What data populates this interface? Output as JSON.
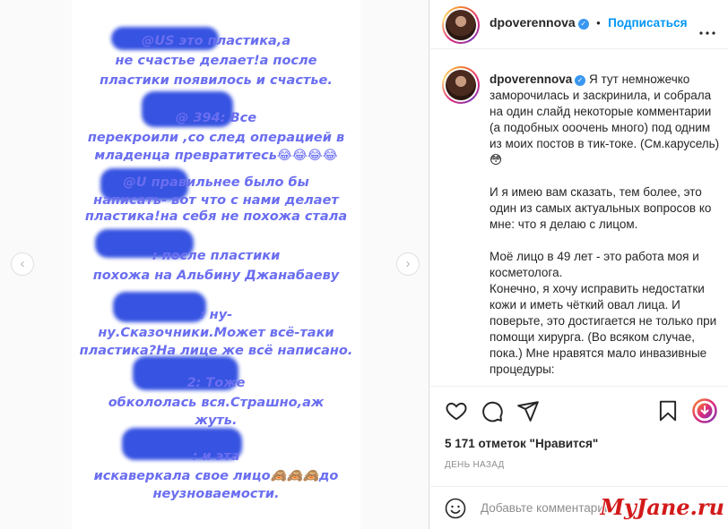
{
  "story": {
    "lines": [
      "@US                это пластика,а",
      "не счастье делает!а после",
      "пластики появилось и счастье.",
      "@            394:  Все",
      "перекроили ,со след операцией в",
      "младенца превратитесь😂😂😂😂",
      "@U                   правильнее было бы",
      "написать- вот что с нами делает",
      "пластика!на себя не похожа стала",
      "                    :  после пластики",
      "похожа на Альбину Джанабаеву",
      "                    :   ну-",
      "ну.Сказочники.Может всё-таки",
      "пластика?На лице же всё написано.",
      "                  2:  Тоже",
      "обкололась вся.Страшно,аж",
      "жуть.",
      "                    :  и эта",
      "искаверкала свое лицо🙈🙈🙈до",
      "неузноваемости."
    ]
  },
  "nav": {
    "prev_icon": "‹",
    "next_icon": "›"
  },
  "header": {
    "username": "dpoverennova",
    "verified_icon": "✓",
    "follow_label": "Подписаться",
    "separator": "•"
  },
  "caption": {
    "username": "dpoverennova",
    "paragraphs": [
      "Я тут немножечко заморочилась и заскринила, и собрала на один слайд некоторые комментарии (а подобных ооочень много) под одним из моих постов в тик-токе. (См.карусель) 😳",
      "И я имею вам сказать, тем более, это один из самых актуальных вопросов ко мне: что я делаю с лицом.",
      "Моё лицо в 49 лет - это работа моя и косметолога.",
      "Конечно, я хочу исправить недостатки кожи и иметь чёткий овал лица. И поверьте, это достигается не только при помощи хирурга. (Во всяком случае, пока.) Мне нравятся мало инвазивные процедуры:"
    ]
  },
  "stats": {
    "likes": "5 171 отметок \"Нравится\"",
    "time": "ДЕНЬ НАЗАД"
  },
  "comment": {
    "placeholder": "Добавьте комментарий",
    "emoji_icon": "☺"
  },
  "watermark": "MyJane.ru",
  "colors": {
    "story_text": "#6a6ef0",
    "redaction": "#2c4ae0",
    "link": "#0095f6",
    "verified": "#3897f0",
    "save_accent": "#dd2a7b"
  }
}
